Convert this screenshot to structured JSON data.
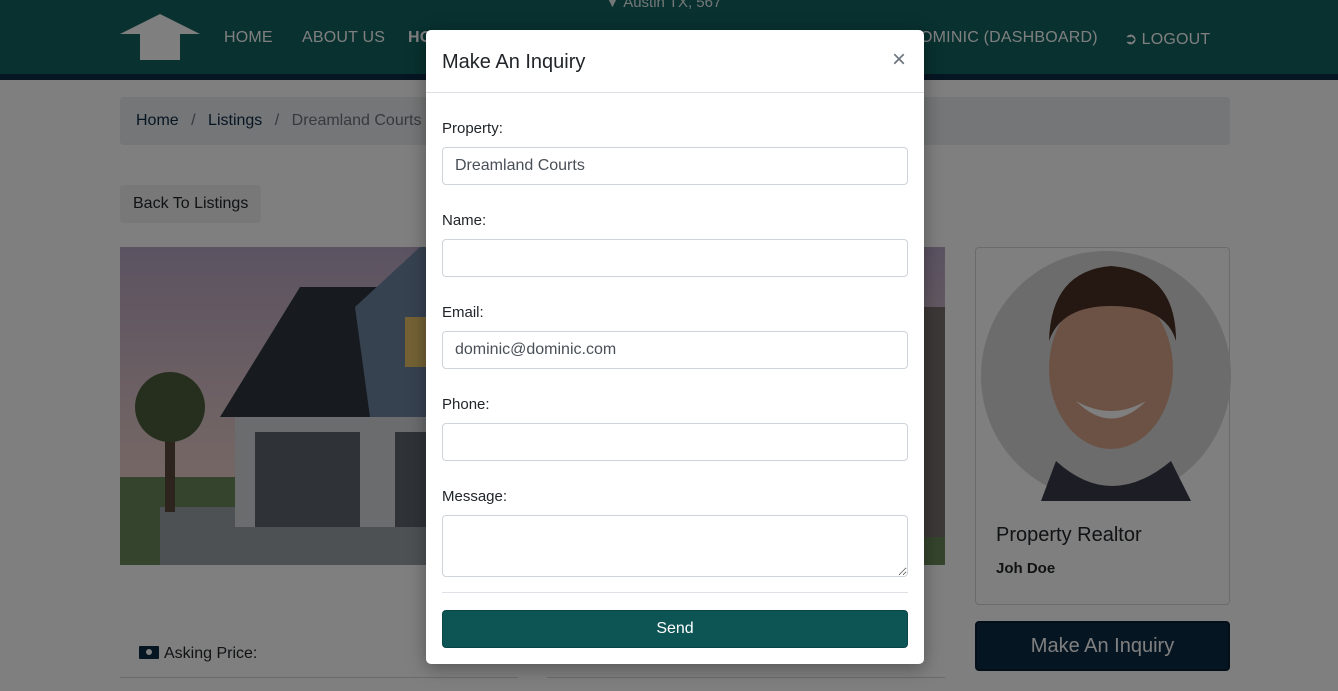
{
  "topbar": {
    "location": "Austin TX, 567"
  },
  "nav": {
    "home": "HOME",
    "about": "ABOUT US",
    "featured": "HO",
    "dashboard": "OMINIC (DASHBOARD)",
    "logout": "LOGOUT"
  },
  "breadcrumb": {
    "home": "Home",
    "listings": "Listings",
    "current": "Dreamland Courts"
  },
  "back_button": "Back To Listings",
  "realtor": {
    "title": "Property Realtor",
    "name": "Joh Doe"
  },
  "inquiry_button": "Make An Inquiry",
  "asking_price_label": "Asking Price:",
  "modal": {
    "title": "Make An Inquiry",
    "close": "×",
    "fields": {
      "property": {
        "label": "Property:",
        "value": "Dreamland Courts"
      },
      "name": {
        "label": "Name:",
        "value": ""
      },
      "email": {
        "label": "Email:",
        "value": "dominic@dominic.com"
      },
      "phone": {
        "label": "Phone:",
        "value": ""
      },
      "message": {
        "label": "Message:",
        "value": ""
      }
    },
    "send": "Send"
  },
  "colors": {
    "brand_teal": "#10625f",
    "navy": "#0d2a45",
    "send_button": "#0d5454"
  },
  "icons": {
    "logo": "house-arrow-icon",
    "location": "map-marker-icon",
    "logout": "sign-out-icon",
    "price": "money-icon",
    "close": "close-icon"
  }
}
